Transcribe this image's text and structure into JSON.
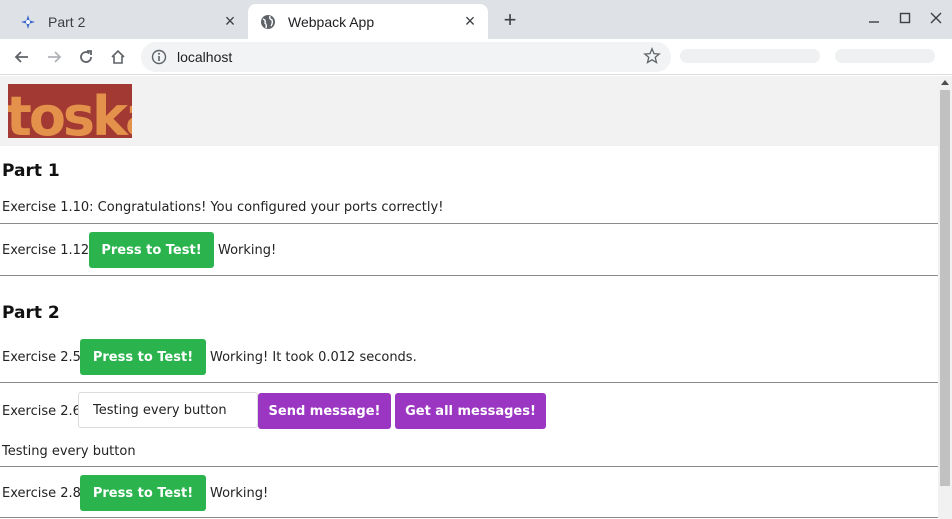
{
  "browser": {
    "tabs": [
      {
        "title": "Part 2",
        "icon": "sparkle-icon",
        "active": false
      },
      {
        "title": "Webpack App",
        "icon": "globe-icon",
        "active": true
      }
    ],
    "url": "localhost"
  },
  "header": {
    "logo_text": "toska",
    "colors": {
      "logo_dark": "#a23a33",
      "logo_light": "#e4924b"
    }
  },
  "part1": {
    "title": "Part 1",
    "ex_1_10": "Exercise 1.10: Congratulations! You configured your ports correctly!",
    "ex_1_12_label": "Exercise 1.12:",
    "ex_1_12_button": "Press to Test!",
    "ex_1_12_status": "Working!"
  },
  "part2": {
    "title": "Part 2",
    "ex_2_5_label": "Exercise 2.5:",
    "ex_2_5_button": "Press to Test!",
    "ex_2_5_status": "Working! It took 0.012 seconds.",
    "ex_2_6_label": "Exercise 2.6:",
    "ex_2_6_input_value": "Testing every button",
    "ex_2_6_send_button": "Send message!",
    "ex_2_6_get_button": "Get all messages!",
    "ex_2_6_message": "Testing every button",
    "ex_2_8_label": "Exercise 2.8:",
    "ex_2_8_button": "Press to Test!",
    "ex_2_8_status": "Working!"
  },
  "colors": {
    "green_button": "#2bb44e",
    "purple_button": "#9b36c2"
  }
}
